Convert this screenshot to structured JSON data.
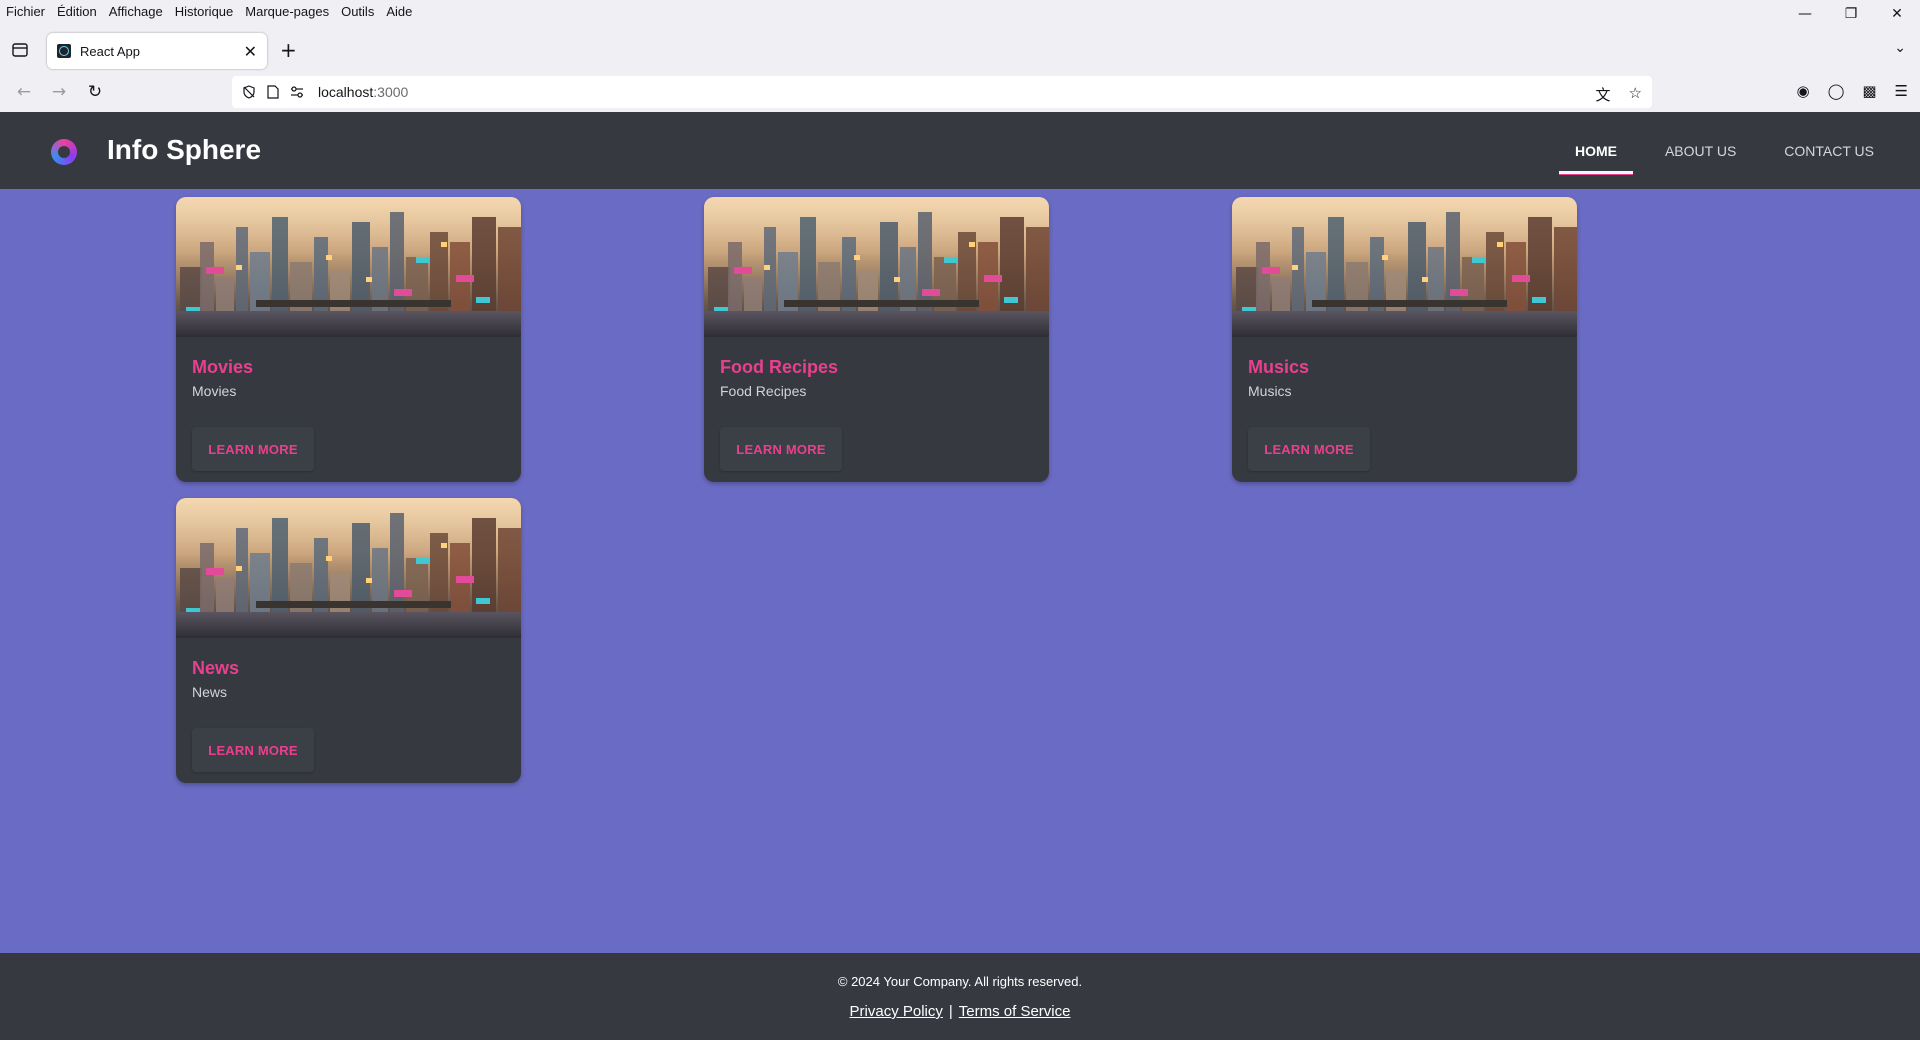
{
  "menu": [
    "Fichier",
    "Édition",
    "Affichage",
    "Historique",
    "Marque-pages",
    "Outils",
    "Aide"
  ],
  "tab": {
    "title": "React App"
  },
  "url": {
    "host": "localhost",
    "port": ":3000"
  },
  "site": {
    "brand": "Info Sphere",
    "nav": [
      "HOME",
      "ABOUT US",
      "CONTACT US"
    ],
    "active_nav": "HOME"
  },
  "cards": [
    {
      "title": "Movies",
      "desc": "Movies",
      "button": "LEARN MORE"
    },
    {
      "title": "Food Recipes",
      "desc": "Food Recipes",
      "button": "LEARN MORE"
    },
    {
      "title": "Musics",
      "desc": "Musics",
      "button": "LEARN MORE"
    },
    {
      "title": "News",
      "desc": "News",
      "button": "LEARN MORE"
    }
  ],
  "footer": {
    "copyright": "© 2024 Your Company. All rights reserved.",
    "privacy": "Privacy Policy",
    "separator": "|",
    "terms": "Terms of Service"
  },
  "colors": {
    "page_bg": "#6a6bc4",
    "header_bg": "#363a40",
    "accent": "#e8408f"
  }
}
